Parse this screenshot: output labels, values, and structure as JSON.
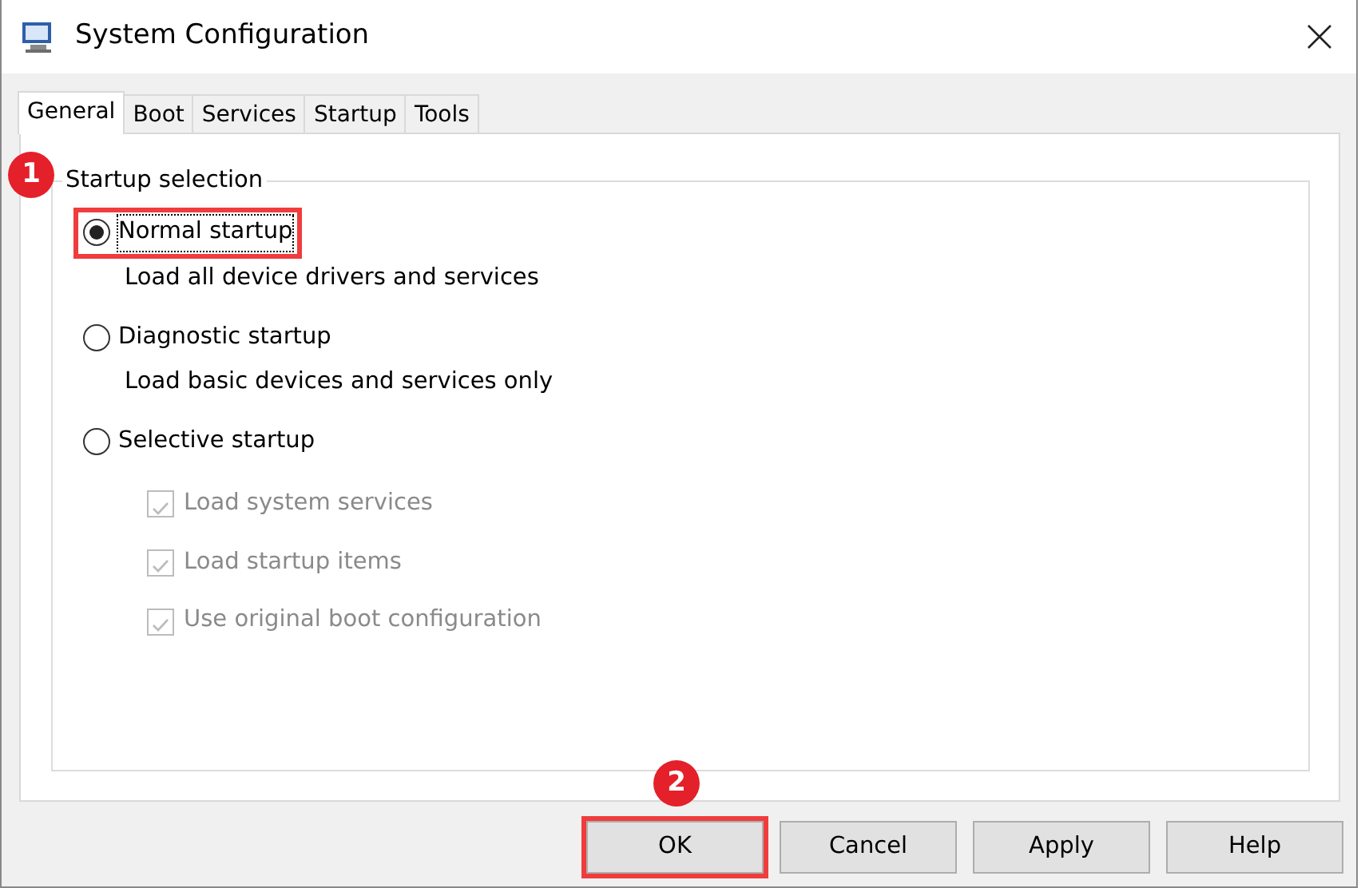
{
  "window": {
    "title": "System Configuration"
  },
  "tabs": [
    {
      "label": "General",
      "selected": true
    },
    {
      "label": "Boot",
      "selected": false
    },
    {
      "label": "Services",
      "selected": false
    },
    {
      "label": "Startup",
      "selected": false
    },
    {
      "label": "Tools",
      "selected": false
    }
  ],
  "startup_selection": {
    "title": "Startup selection",
    "callout": "1",
    "options": [
      {
        "label": "Normal startup",
        "selected": true,
        "highlighted": true,
        "description": "Load all device drivers and services"
      },
      {
        "label": "Diagnostic startup",
        "selected": false,
        "highlighted": false,
        "description": "Load basic devices and services only"
      },
      {
        "label": "Selective startup",
        "selected": false,
        "highlighted": false
      }
    ],
    "selective_items": [
      {
        "label": "Load system services",
        "checked": true,
        "disabled": true
      },
      {
        "label": "Load startup items",
        "checked": true,
        "disabled": true
      },
      {
        "label": "Use original boot configuration",
        "checked": true,
        "disabled": true
      }
    ]
  },
  "buttons": [
    {
      "label": "OK",
      "highlighted": true,
      "callout": "2"
    },
    {
      "label": "Cancel",
      "highlighted": false
    },
    {
      "label": "Apply",
      "highlighted": false
    },
    {
      "label": "Help",
      "highlighted": false
    }
  ]
}
